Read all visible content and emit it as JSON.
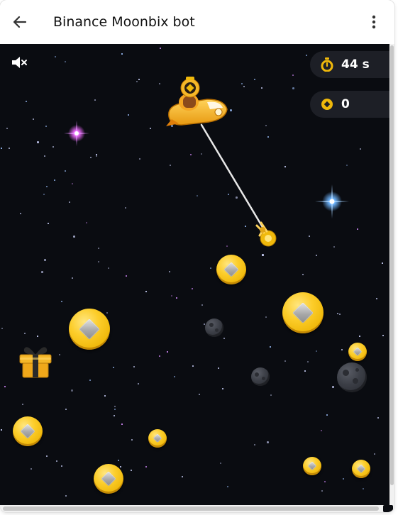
{
  "header": {
    "title": "Binance Moonbix bot",
    "back_icon": "arrow-left-icon",
    "more_icon": "more-vertical-icon"
  },
  "hud": {
    "timer_icon": "stopwatch-icon",
    "timer_text": "44 s",
    "score_icon": "coin-icon",
    "score_text": "0"
  },
  "game": {
    "mute_icon": "volume-mute-icon",
    "gift_icon": "gift-box-icon",
    "player_icon": "rocket-ship-icon",
    "claw_icon": "grabber-claw-icon",
    "colors": {
      "background": "#0a0c11",
      "coin": "#f0b90b",
      "hud_pill": "#1d1f26"
    }
  }
}
